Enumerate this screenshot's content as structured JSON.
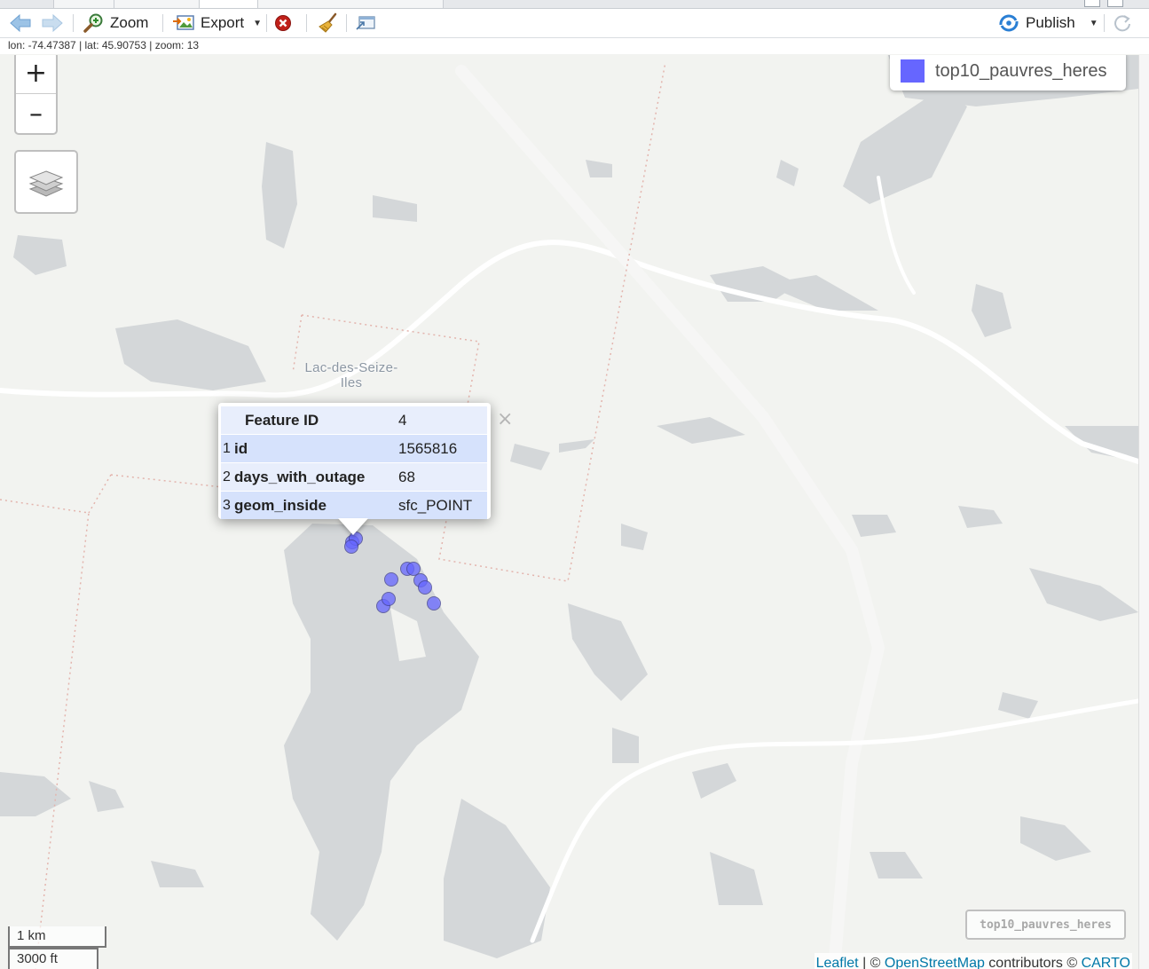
{
  "toolbar": {
    "zoom_label": "Zoom",
    "export_label": "Export",
    "publish_label": "Publish"
  },
  "status": {
    "lon": "-74.47387",
    "lat": "45.90753",
    "zoom": "13",
    "text": "lon: -74.47387 | lat: 45.90753 | zoom: 13"
  },
  "map": {
    "zoom_in_label": "+",
    "zoom_out_label": "–",
    "place_label_line1": "Lac-des-Seize-",
    "place_label_line2": "Iles",
    "legend": {
      "label": "top10_pauvres_heres",
      "color": "#6666ff"
    },
    "layer_badge": "top10_pauvres_heres",
    "scale": {
      "metric": "1 km",
      "imperial": "3000 ft"
    },
    "attribution": {
      "leaflet": "Leaflet",
      "sep1": " | © ",
      "osm": "OpenStreetMap",
      "mid": " contributors © ",
      "carto": "CARTO"
    },
    "marker_color": "#6666ff"
  },
  "popup": {
    "header": {
      "key": "Feature ID",
      "value": "4"
    },
    "rows": [
      {
        "index": "1",
        "key": "id",
        "value": "1565816"
      },
      {
        "index": "2",
        "key": "days_with_outage",
        "value": "68"
      },
      {
        "index": "3",
        "key": "geom_inside",
        "value": "sfc_POINT"
      }
    ],
    "close_label": "×"
  }
}
